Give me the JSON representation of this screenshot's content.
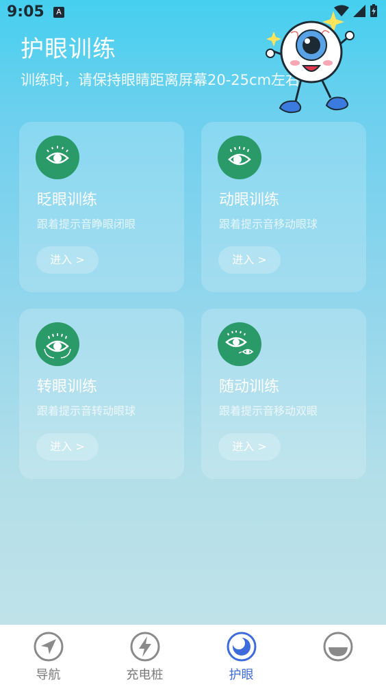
{
  "status_bar": {
    "time": "9:05",
    "notification_glyph": "A"
  },
  "header": {
    "title": "护眼训练",
    "subtitle": "训练时，请保持眼睛距离屏幕20-25cm左右",
    "mascot": "eyeball-mascot"
  },
  "cards": [
    {
      "title": "眨眼训练",
      "desc": "跟着提示音睁眼闭眼",
      "button": "进入 >",
      "icon": "blink-eye-icon"
    },
    {
      "title": "动眼训练",
      "desc": "跟着提示音移动眼球",
      "button": "进入 >",
      "icon": "move-eye-icon"
    },
    {
      "title": "转眼训练",
      "desc": "跟着提示音转动眼球",
      "button": "进入 >",
      "icon": "rotate-eye-icon"
    },
    {
      "title": "随动训练",
      "desc": "跟着提示音移动双眼",
      "button": "进入 >",
      "icon": "follow-eye-icon"
    }
  ],
  "tabs": [
    {
      "label": "导航",
      "icon": "navigation-icon",
      "active": false
    },
    {
      "label": "充电桩",
      "icon": "charging-icon",
      "active": false
    },
    {
      "label": "护眼",
      "icon": "eye-care-icon",
      "active": true
    },
    {
      "label": "",
      "icon": "profile-icon",
      "active": false
    }
  ],
  "colors": {
    "accent": "#3e6bdb",
    "icon_green": "#2a9a68",
    "tab_inactive": "#8a8a8a"
  }
}
